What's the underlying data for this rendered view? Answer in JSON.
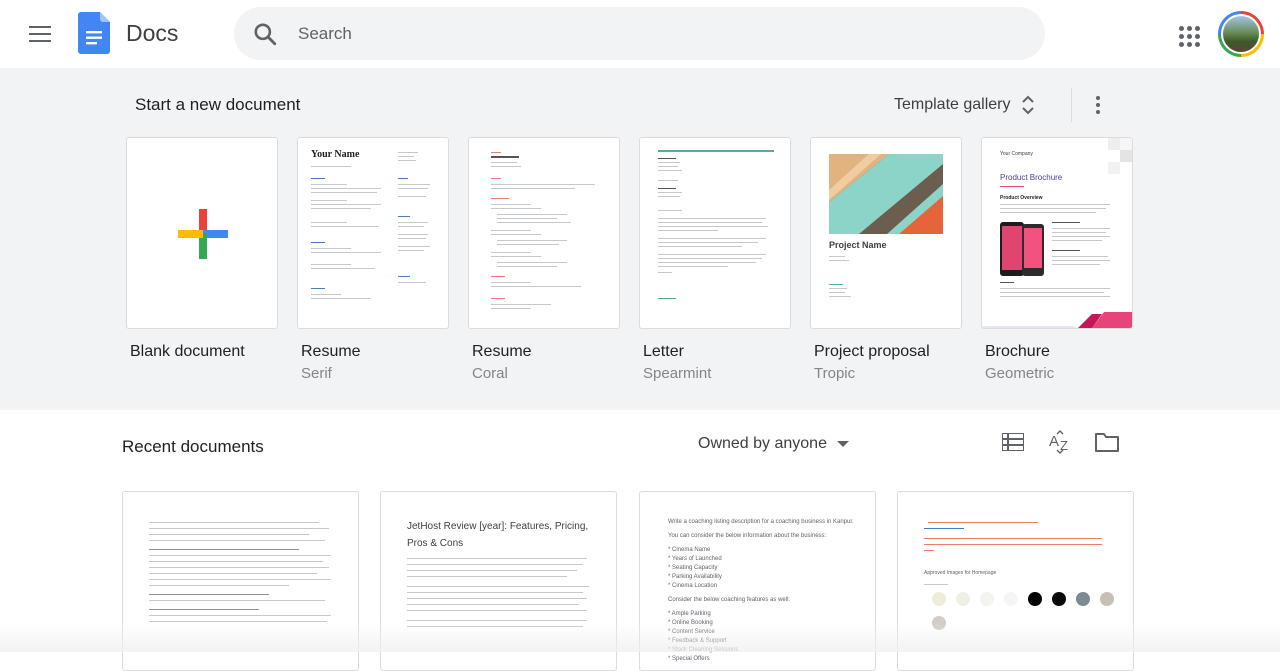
{
  "app": {
    "title": "Docs"
  },
  "search": {
    "placeholder": "Search"
  },
  "templates": {
    "heading": "Start a new document",
    "gallery_label": "Template gallery",
    "items": [
      {
        "name": "Blank document",
        "subtitle": ""
      },
      {
        "name": "Resume",
        "subtitle": "Serif",
        "thumb_title": "Your Name"
      },
      {
        "name": "Resume",
        "subtitle": "Coral"
      },
      {
        "name": "Letter",
        "subtitle": "Spearmint"
      },
      {
        "name": "Project proposal",
        "subtitle": "Tropic",
        "thumb_title": "Project Name"
      },
      {
        "name": "Brochure",
        "subtitle": "Geometric",
        "thumb_company": "Your Company",
        "thumb_title": "Product Brochure",
        "thumb_section": "Product Overview"
      }
    ]
  },
  "recent": {
    "heading": "Recent documents",
    "owner_filter": "Owned by anyone",
    "docs": [
      {
        "preview_title": "",
        "preview_text": ""
      },
      {
        "preview_title": "JetHost Review [year]: Features, Pricing, Pros & Cons",
        "preview_text": ""
      },
      {
        "preview_title": "",
        "preview_lines": [
          "Write a coaching listing description for a coaching business in Kanpur.",
          "You can consider the below information about the business:",
          "* Cinema Name",
          "* Years of Launched",
          "* Seating Capacity",
          "* Parking Availability",
          "* Cinema Location",
          "Consider the below coaching features as well:",
          "* Ample Parking",
          "* Online Booking",
          "* Content Service",
          "* Feedback & Support",
          "* Stock Cleaning Sessions",
          "* Special Offers"
        ]
      },
      {
        "preview_title": "",
        "preview_text": "Approved Images for Homepage"
      }
    ]
  },
  "colors": {
    "accent": "#4285f4",
    "background_templates": "#f1f3f4",
    "text": "#202124"
  },
  "icons": [
    "menu-icon",
    "docs-logo-icon",
    "search-icon",
    "apps-grid-icon",
    "unfold-icon",
    "more-vert-icon",
    "list-view-icon",
    "sort-az-icon",
    "folder-icon"
  ]
}
